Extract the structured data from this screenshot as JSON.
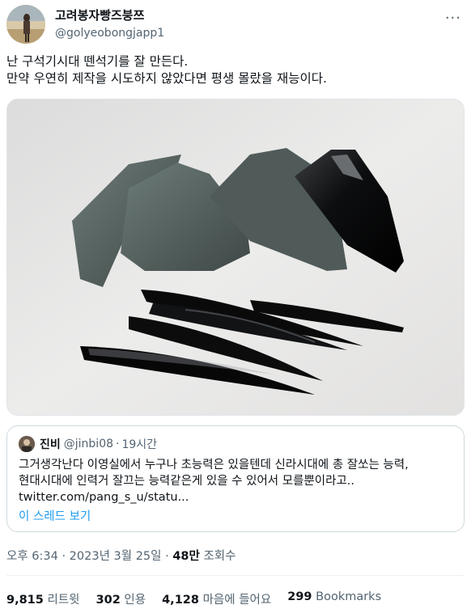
{
  "author": {
    "display_name": "고려봉자빵즈붕쯔",
    "handle": "@golyeobongjapp1"
  },
  "tweet": {
    "lines": [
      "난 구석기시대 뗀석기를 잘 만든다.",
      "만약 우연히 제작을 시도하지 않았다면 평생 몰랐을 재능이다."
    ]
  },
  "quote": {
    "name": "진비",
    "handle": "@jinbi08",
    "separator": "·",
    "time": "19시간",
    "lines": [
      "그거생각난다 이영실에서 누구나 초능력은 있을텐데 신라시대에 총 잘쏘는 능력,",
      "현대시대에 인력거 잘끄는 능력같은게 있을 수 있어서 모를뿐이라고..",
      "twitter.com/pang_s_u/statu..."
    ],
    "thread_link": "이 스레드 보기"
  },
  "meta": {
    "timestamp": "오후 6:34 · 2023년 3월 25일 · ",
    "views_count": "48만",
    "views_label": " 조회수"
  },
  "stats": {
    "retweets_count": "9,815",
    "retweets_label": " 리트윗",
    "quotes_count": "302",
    "quotes_label": " 인용",
    "likes_count": "4,128",
    "likes_label": " 마음에 들어요",
    "bookmarks_count": "299",
    "bookmarks_label": " Bookmarks"
  },
  "colors": {
    "accent": "#1d9bf0",
    "secondary_text": "#536471",
    "primary_text": "#0f1419"
  }
}
